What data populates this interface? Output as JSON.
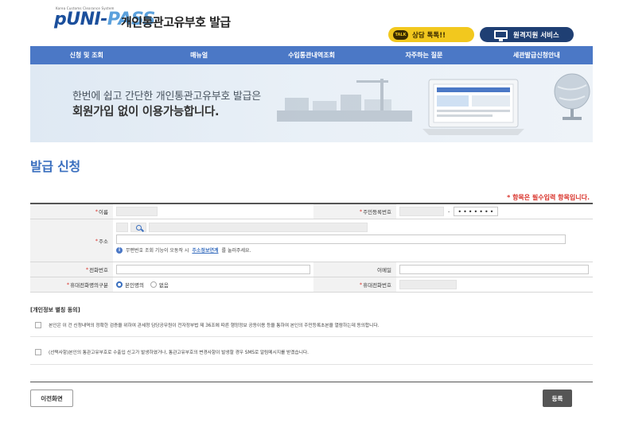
{
  "header": {
    "logo_tag": "Korea Customs Clearance System",
    "logo_p": "p",
    "logo_uni": "UNI-",
    "logo_pass": "PASS",
    "title": "개인통관고유부호 발급",
    "chat_button": "상담 톡톡!!",
    "chat_bubble": "TALK",
    "remote_button": "원격지원 서비스"
  },
  "nav": {
    "items": [
      "신청 및 조회",
      "매뉴얼",
      "수입통관내역조회",
      "자주하는 질문",
      "세관발급신청안내"
    ]
  },
  "banner": {
    "line1_prefix": "한번에 쉽고 간단한 ",
    "line1_suffix": "개인통관고유부호 발급은",
    "line2": "회원가입 없이 이용가능합니다."
  },
  "page": {
    "title": "발급 신청",
    "required_note": "* 항목은 필수입력 항목입니다."
  },
  "form": {
    "name_label": "이름",
    "rrn_label": "주민등록번호",
    "rrn_dash": "-",
    "rrn_masked": "•••••••",
    "address_label": "주소",
    "address_info_prefix": "무편번호 조회 기능이 오동작 시 ",
    "address_info_link": "주소정보연계",
    "address_info_suffix": "를 눌러주세요.",
    "phone_label": "전화번호",
    "email_label": "이메일",
    "mobile_type_label": "휴대전화명의구분",
    "mobile_type_options": [
      "본인명의",
      "없음"
    ],
    "mobile_label": "휴대전화번호",
    "required_mark": "*"
  },
  "consent": {
    "title": "[개인정보 별칭 동의]",
    "item1": "본인은 이 건 신청내역의 정확한 검증을 위하여 관세청 담당공무원이 전자정부법 제 36조에 따른 행정정보 공동이용 등을 통하여 본인의 주민등록초본을 열람하는데 동의합니다.",
    "item2": "(선택사항)본인의 통관고유부호로 수출입 신고가 발생하였거나, 통관고유부호의 변경사항이 발생할 경우 SMS로 알림메시지를 받겠습니다."
  },
  "buttons": {
    "prev": "이전화면",
    "register": "등록"
  },
  "colors": {
    "nav": "#4b78c6",
    "title": "#3a6fbf",
    "required": "#d9332b",
    "chat": "#f2c81e",
    "remote": "#1f3f73"
  },
  "icons": {
    "search": "search-icon",
    "info": "info-icon",
    "chat": "chat-bubble-icon",
    "monitor": "monitor-icon"
  }
}
